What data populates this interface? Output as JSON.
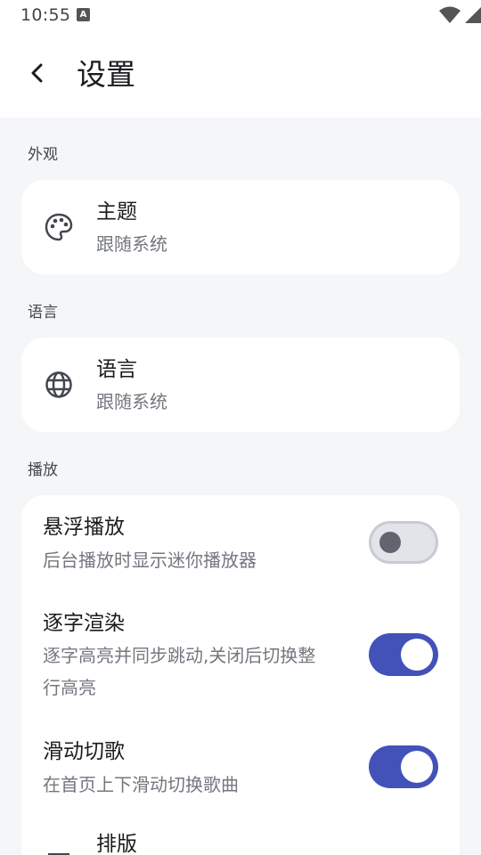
{
  "status_bar": {
    "time": "10:55",
    "notification_icon_letter": "A",
    "icons": [
      "wifi-icon",
      "signal-icon",
      "battery-charging-icon"
    ]
  },
  "app_bar": {
    "back_icon": "chevron-left-icon",
    "title": "设置"
  },
  "sections": {
    "appearance": {
      "label": "外观",
      "theme": {
        "icon": "palette-icon",
        "title": "主题",
        "subtitle": "跟随系统"
      }
    },
    "language": {
      "label": "语言",
      "language": {
        "icon": "globe-icon",
        "title": "语言",
        "subtitle": "跟随系统"
      }
    },
    "playback": {
      "label": "播放",
      "items": [
        {
          "title": "悬浮播放",
          "subtitle": "后台播放时显示迷你播放器",
          "enabled": false
        },
        {
          "title": "逐字渲染",
          "subtitle_line1": "逐字高亮并同步跳动,关闭后切换整",
          "subtitle_line2": "行高亮",
          "enabled": true
        },
        {
          "title": "滑动切歌",
          "subtitle": "在首页上下滑动切换歌曲",
          "enabled": true
        },
        {
          "icon": "layout-icon",
          "title": "排版"
        }
      ]
    }
  },
  "colors": {
    "accent": "#4352b8",
    "background": "#f5f6f8",
    "card": "#ffffff"
  }
}
